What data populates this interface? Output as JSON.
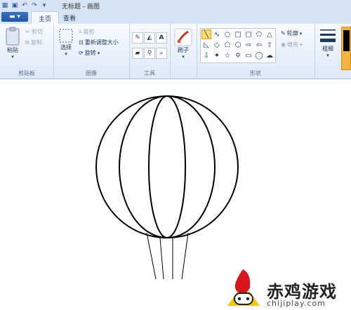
{
  "window": {
    "title": "无标题 - 画图"
  },
  "tabs": {
    "file": "",
    "home": "主页",
    "view": "查看"
  },
  "clipboard": {
    "paste": "粘贴",
    "cut": "剪切",
    "copy": "复制",
    "group_label": "剪贴板"
  },
  "image": {
    "select": "选择",
    "crop": "裁剪",
    "resize": "重新调整大小",
    "rotate": "旋转",
    "group_label": "图像"
  },
  "tools": {
    "group_label": "工具",
    "text_tool": "A"
  },
  "brushes": {
    "label": "刷子"
  },
  "shapes": {
    "group_label": "形状",
    "outline": "轮廓",
    "fill": "填充"
  },
  "size": {
    "label": "粗细"
  },
  "watermark": {
    "brand": "赤鸡游戏",
    "domain": "chijiplay.com"
  }
}
